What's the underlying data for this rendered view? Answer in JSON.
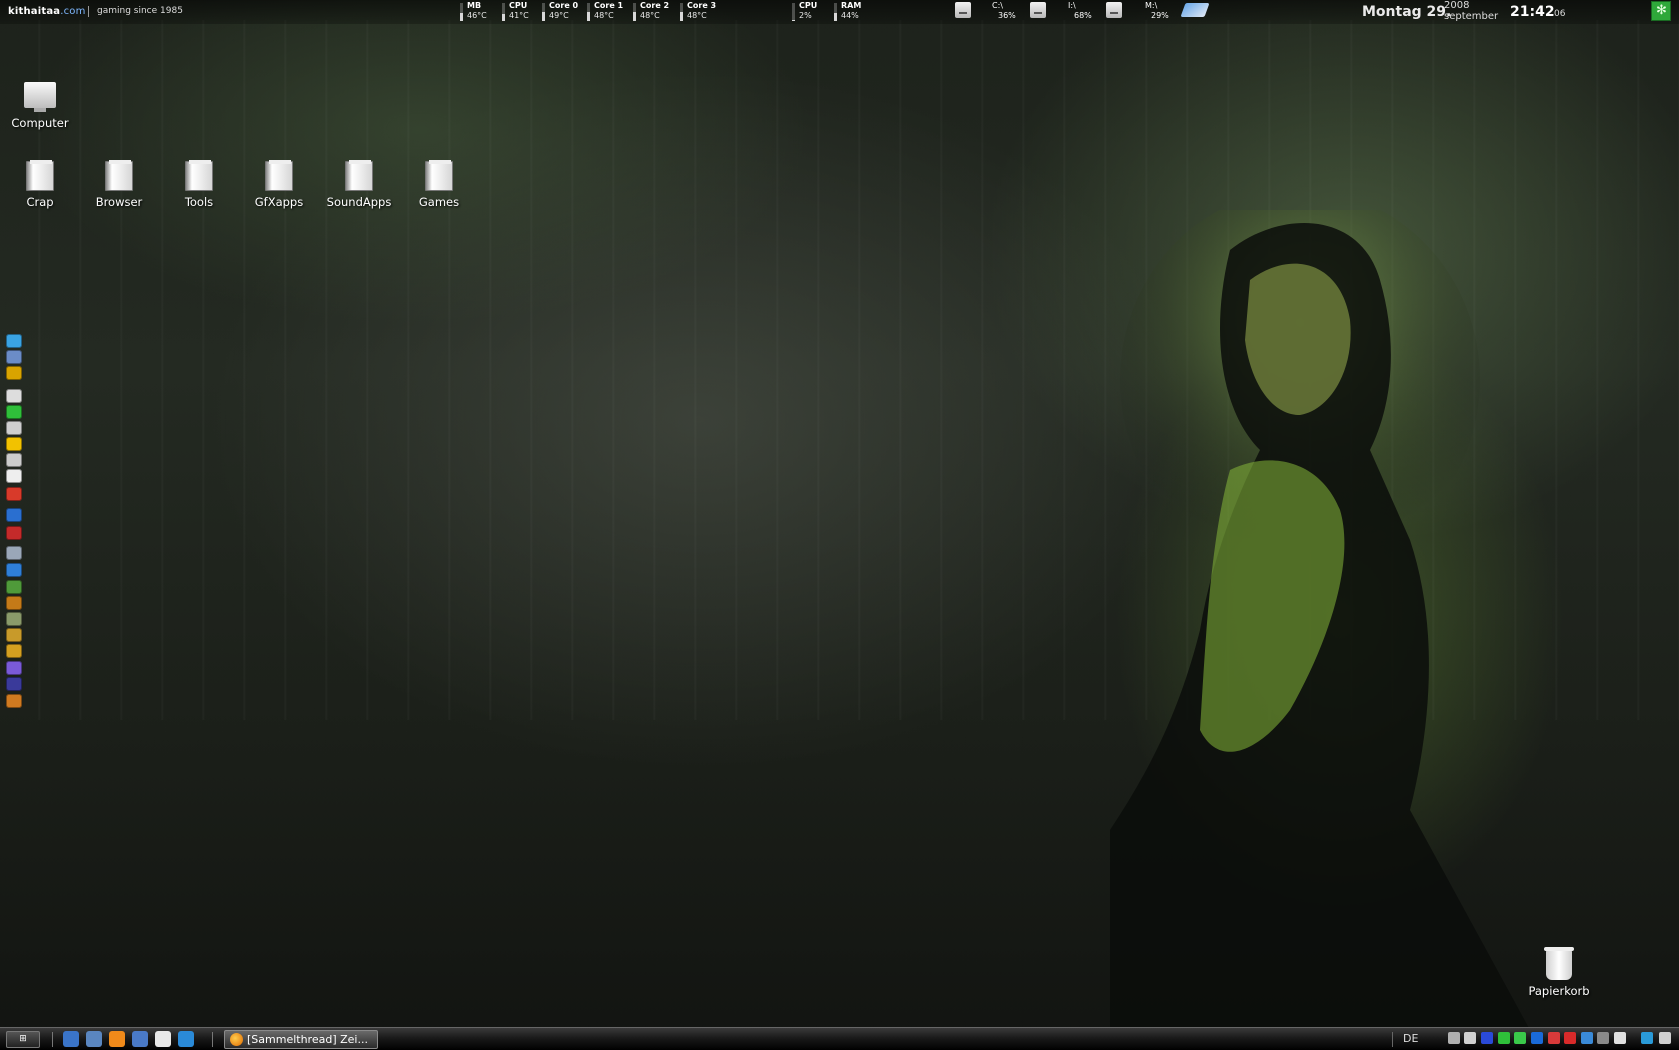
{
  "topbar": {
    "brand_main": "kithaitaa",
    "brand_dot": ".com",
    "tagline": "gaming since 1985",
    "sensors": [
      {
        "label": "MB",
        "value": "46°C",
        "level": 0.46
      },
      {
        "label": "CPU",
        "value": "41°C",
        "level": 0.41
      },
      {
        "label": "Core 0",
        "value": "49°C",
        "level": 0.49
      },
      {
        "label": "Core 1",
        "value": "48°C",
        "level": 0.48
      },
      {
        "label": "Core 2",
        "value": "48°C",
        "level": 0.48
      },
      {
        "label": "Core 3",
        "value": "48°C",
        "level": 0.48
      },
      {
        "label": "CPU",
        "value": "2%",
        "level": 0.02
      },
      {
        "label": "RAM",
        "value": "44%",
        "level": 0.44
      }
    ],
    "drives": [
      {
        "label": "C:\\",
        "value": "36%"
      },
      {
        "label": "I:\\",
        "value": "68%"
      },
      {
        "label": "M:\\",
        "value": "29%"
      }
    ],
    "clock": {
      "date": "Montag 29.",
      "year": "2008",
      "month": "september",
      "time": "21:42",
      "seconds": "06"
    }
  },
  "desktop": {
    "computer_label": "Computer",
    "folders": [
      "Crap",
      "Browser",
      "Tools",
      "GfXapps",
      "SoundApps",
      "Games"
    ],
    "trash_label": "Papierkorb"
  },
  "dock": {
    "items": [
      "skype-icon",
      "teamspeak-icon",
      "game-icon",
      "bell-icon",
      "game-icon",
      "game-icon",
      "pencil-icon",
      "game-icon",
      "game-icon",
      "game-icon",
      "game-icon",
      "game-icon",
      "game-icon",
      "game-icon",
      "game-icon",
      "game-icon",
      "game-icon",
      "game-icon",
      "game-icon",
      "game-icon",
      "game-icon",
      "game-icon"
    ],
    "colors": [
      "#3aa3e3",
      "#6b8cc7",
      "#d9a400",
      "#dddddd",
      "#2fbf3a",
      "#cfcfcf",
      "#f2c200",
      "#cccccc",
      "#eeeeee",
      "#d83a2a",
      "#2a6fd0",
      "#c42a2a",
      "#9aa7b8",
      "#2f7fd8",
      "#4f9a3a",
      "#c47a18",
      "#8a9a6a",
      "#c89a2a",
      "#d4a020",
      "#7a5ad8",
      "#3a3a9a",
      "#d07a20"
    ]
  },
  "taskbar": {
    "start_label": "⊞",
    "quicklaunch_colors": [
      "#3a74c8",
      "#5a86c0",
      "#f08a1a",
      "#4a7ac8",
      "#e8e8e8",
      "#2a8ad8"
    ],
    "task_label": "[Sammelthread] Zei...",
    "language": "DE",
    "tray_colors": [
      "#b0b0b0",
      "#d0d0d0",
      "#2a4ad8",
      "#2fbf3a",
      "#3ac84a",
      "#1a6ad8",
      "#d83a3a",
      "#d82a2a",
      "#3a8ad8",
      "#8a8a8a",
      "#e0e0e0",
      "#2a9ad8",
      "#d0d0d0"
    ]
  }
}
